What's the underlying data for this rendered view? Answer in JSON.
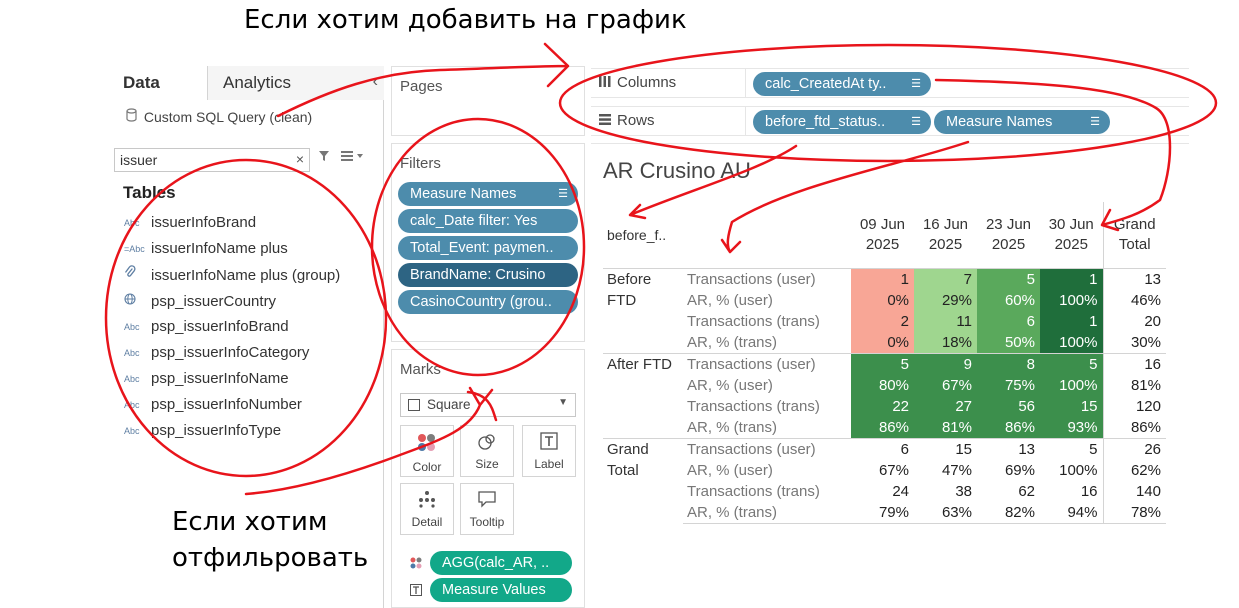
{
  "annotations": {
    "top_note": "Если хотим добавить на график",
    "bottom_note": "Если хотим отфильровать"
  },
  "data_pane": {
    "tabs": [
      "Data",
      "Analytics"
    ],
    "collapse_glyph": "‹",
    "datasource": "Custom SQL Query (clean)",
    "search": {
      "value": "issuer",
      "clear_glyph": "×"
    },
    "tables_heading": "Tables",
    "fields": [
      {
        "name": "issuerInfoBrand",
        "icon": "Abc"
      },
      {
        "name": "issuerInfoName plus",
        "icon": "=Abc"
      },
      {
        "name": "issuerInfoName plus (group)",
        "icon": "paperclip-icon"
      },
      {
        "name": "psp_issuerCountry",
        "icon": "globe-icon"
      },
      {
        "name": "psp_issuerInfoBrand",
        "icon": "Abc"
      },
      {
        "name": "psp_issuerInfoCategory",
        "icon": "Abc"
      },
      {
        "name": "psp_issuerInfoName",
        "icon": "Abc"
      },
      {
        "name": "psp_issuerInfoNumber",
        "icon": "Abc"
      },
      {
        "name": "psp_issuerInfoType",
        "icon": "Abc"
      }
    ]
  },
  "pages": {
    "title": "Pages"
  },
  "filters": {
    "title": "Filters",
    "items": [
      "Measure Names",
      "calc_Date filter: Yes",
      "Total_Event: paymen..",
      "BrandName: Crusino",
      "CasinoCountry (grou.."
    ]
  },
  "marks": {
    "title": "Marks",
    "mark_type": "Square",
    "buttons": [
      "Color",
      "Size",
      "Label",
      "Detail",
      "Tooltip"
    ],
    "fields": [
      "AGG(calc_AR, ..",
      "Measure Values"
    ]
  },
  "columns": {
    "label": "Columns",
    "pills": [
      "calc_CreatedAt ty.."
    ]
  },
  "rows": {
    "label": "Rows",
    "pills": [
      "before_ftd_status..",
      "Measure Names"
    ]
  },
  "colors": {
    "pill_blue": "#4d8cac",
    "pill_dark": "#2d6483",
    "pill_green": "#12a889",
    "ink": "#e8141b"
  },
  "view": {
    "title": "AR Crusino AU",
    "row_header": "before_f..",
    "columns": [
      [
        "09 Jun",
        "2025"
      ],
      [
        "16 Jun",
        "2025"
      ],
      [
        "23 Jun",
        "2025"
      ],
      [
        "30 Jun",
        "2025"
      ]
    ],
    "grand_total_header": [
      "Grand",
      "Total"
    ],
    "groups": [
      {
        "name": [
          "Before",
          "FTD"
        ],
        "rows": [
          {
            "measure": "Transactions (user)",
            "cells": [
              "1",
              "7",
              "5",
              "1"
            ],
            "colors": [
              "#f8a696",
              "#9fd68f",
              "#5aa95c",
              "#1f6e3b"
            ],
            "total": "13"
          },
          {
            "measure": "AR, % (user)",
            "cells": [
              "0%",
              "29%",
              "60%",
              "100%"
            ],
            "colors": [
              "#f8a696",
              "#9fd68f",
              "#5aa95c",
              "#1f6e3b"
            ],
            "total": "46%"
          },
          {
            "measure": "Transactions (trans)",
            "cells": [
              "2",
              "11",
              "6",
              "1"
            ],
            "colors": [
              "#f8a696",
              "#9fd68f",
              "#5aa95c",
              "#1f6e3b"
            ],
            "total": "20"
          },
          {
            "measure": "AR, % (trans)",
            "cells": [
              "0%",
              "18%",
              "50%",
              "100%"
            ],
            "colors": [
              "#f8a696",
              "#9fd68f",
              "#5aa95c",
              "#1f6e3b"
            ],
            "total": "30%"
          }
        ]
      },
      {
        "name": [
          "After FTD"
        ],
        "rows": [
          {
            "measure": "Transactions (user)",
            "cells": [
              "5",
              "9",
              "8",
              "5"
            ],
            "colors": [
              "#3c8f4c",
              "#3c8f4c",
              "#3c8f4c",
              "#3c8f4c"
            ],
            "total": "16"
          },
          {
            "measure": "AR, % (user)",
            "cells": [
              "80%",
              "67%",
              "75%",
              "100%"
            ],
            "colors": [
              "#3c8f4c",
              "#3c8f4c",
              "#3c8f4c",
              "#3c8f4c"
            ],
            "total": "81%"
          },
          {
            "measure": "Transactions (trans)",
            "cells": [
              "22",
              "27",
              "56",
              "15"
            ],
            "colors": [
              "#3c8f4c",
              "#3c8f4c",
              "#3c8f4c",
              "#3c8f4c"
            ],
            "total": "120"
          },
          {
            "measure": "AR, % (trans)",
            "cells": [
              "86%",
              "81%",
              "86%",
              "93%"
            ],
            "colors": [
              "#3c8f4c",
              "#3c8f4c",
              "#3c8f4c",
              "#3c8f4c"
            ],
            "total": "86%"
          }
        ]
      },
      {
        "name": [
          "Grand",
          "Total"
        ],
        "rows": [
          {
            "measure": "Transactions (user)",
            "cells": [
              "6",
              "15",
              "13",
              "5"
            ],
            "colors": [
              "#ffffff",
              "#ffffff",
              "#ffffff",
              "#ffffff"
            ],
            "total": "26"
          },
          {
            "measure": "AR, % (user)",
            "cells": [
              "67%",
              "47%",
              "69%",
              "100%"
            ],
            "colors": [
              "#ffffff",
              "#ffffff",
              "#ffffff",
              "#ffffff"
            ],
            "total": "62%"
          },
          {
            "measure": "Transactions (trans)",
            "cells": [
              "24",
              "38",
              "62",
              "16"
            ],
            "colors": [
              "#ffffff",
              "#ffffff",
              "#ffffff",
              "#ffffff"
            ],
            "total": "140"
          },
          {
            "measure": "AR, % (trans)",
            "cells": [
              "79%",
              "63%",
              "82%",
              "94%"
            ],
            "colors": [
              "#ffffff",
              "#ffffff",
              "#ffffff",
              "#ffffff"
            ],
            "total": "78%"
          }
        ]
      }
    ]
  }
}
